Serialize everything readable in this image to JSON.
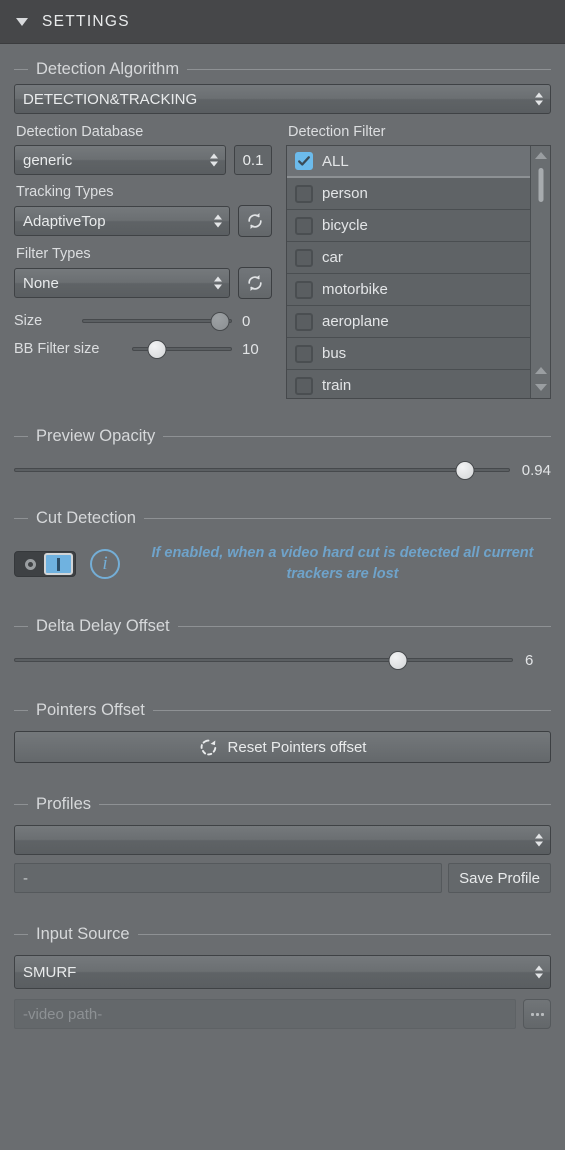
{
  "titlebar": {
    "title": "SETTINGS",
    "collapse_icon": "triangle-down-icon"
  },
  "detection_algorithm": {
    "group_title": "Detection Algorithm",
    "mode": "DETECTION&TRACKING",
    "database_label": "Detection Database",
    "database_value": "generic",
    "threshold_value": "0.1",
    "tracking_label": "Tracking Types",
    "tracking_value": "AdaptiveTop",
    "filter_label": "Filter Types",
    "filter_value": "None",
    "size_label": "Size",
    "size_value": "0",
    "size_percent": 92,
    "bb_label": "BB Filter size",
    "bb_value": "10",
    "bb_percent": 25,
    "refresh_icon": "refresh-icon"
  },
  "detection_filter": {
    "label": "Detection Filter",
    "items": [
      {
        "label": "ALL",
        "checked": true,
        "selected": true
      },
      {
        "label": "person",
        "checked": false,
        "selected": false
      },
      {
        "label": "bicycle",
        "checked": false,
        "selected": false
      },
      {
        "label": "car",
        "checked": false,
        "selected": false
      },
      {
        "label": "motorbike",
        "checked": false,
        "selected": false
      },
      {
        "label": "aeroplane",
        "checked": false,
        "selected": false
      },
      {
        "label": "bus",
        "checked": false,
        "selected": false
      },
      {
        "label": "train",
        "checked": false,
        "selected": false
      }
    ]
  },
  "preview_opacity": {
    "group_title": "Preview Opacity",
    "value": "0.94",
    "percent": 91
  },
  "cut_detection": {
    "group_title": "Cut Detection",
    "toggle_state": "on",
    "info_icon": "info-icon",
    "hint": "If enabled, when a video hard cut is detected all current trackers are lost",
    "hint_color": "#6fa3ca"
  },
  "delta_delay": {
    "group_title": "Delta Delay Offset",
    "value": "6",
    "percent": 77
  },
  "pointers_offset": {
    "group_title": "Pointers Offset",
    "button_label": "Reset Pointers offset",
    "button_icon": "reset-spinner-icon"
  },
  "profiles": {
    "group_title": "Profiles",
    "selected": "",
    "name_value": "-",
    "save_label": "Save Profile"
  },
  "input_source": {
    "group_title": "Input Source",
    "source_value": "SMURF",
    "path_placeholder": "-video path-",
    "browse_label": "...",
    "browse_icon": "ellipsis-icon"
  },
  "colors": {
    "panel_bg": "#6a6d70",
    "titlebar_bg": "#464749",
    "accent_blue": "#6cbbec",
    "hint_blue": "#6fa3ca"
  }
}
